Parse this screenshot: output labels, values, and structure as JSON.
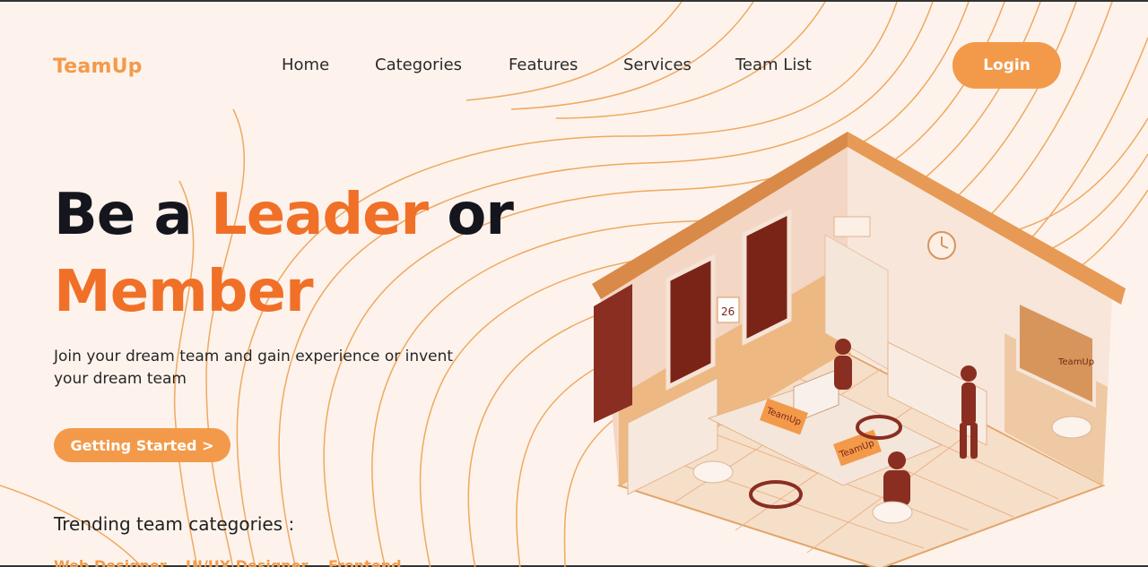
{
  "brand": {
    "name": "TeamUp"
  },
  "nav": {
    "items": [
      {
        "label": "Home"
      },
      {
        "label": "Categories"
      },
      {
        "label": "Features"
      },
      {
        "label": "Services"
      },
      {
        "label": "Team List"
      }
    ],
    "login_label": "Login"
  },
  "hero": {
    "headline_part1": "Be a ",
    "headline_accent1": "Leader",
    "headline_part2": " or",
    "headline_accent2": "Member",
    "subtitle": "Join your dream team and gain experience or invent your dream team",
    "cta_label": "Getting Started >"
  },
  "trending": {
    "title": "Trending team categories :",
    "tags": [
      {
        "label": "Web Designer"
      },
      {
        "label": "UI/UX Designer"
      },
      {
        "label": "Frontend"
      }
    ]
  },
  "illustration": {
    "calendar_day": "26",
    "sign_label_1": "TeamUp",
    "sign_label_2": "TeamUp",
    "board_label": "TeamUp"
  },
  "colors": {
    "background": "#fdf3ec",
    "brand_orange": "#f39a4a",
    "headline_accent": "#f07028",
    "text_dark": "#15161d",
    "wall_red": "#8a2e22"
  },
  "icons": {
    "cta_chevron": "chevron-right-icon"
  }
}
